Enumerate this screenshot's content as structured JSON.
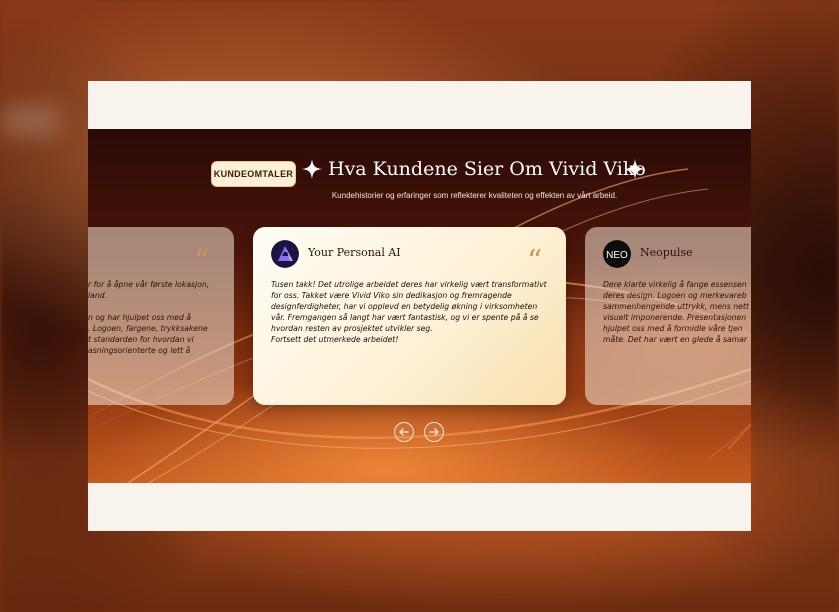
{
  "section": {
    "badge": "KUNDEOMTALER",
    "title": "Hva Kundene Sier Om Vivid Viko",
    "subtitle": "Kundehistorier og erfaringer som reflekterer kvaliteten og effekten av vårt arbeid."
  },
  "testimonials": [
    {
      "company": "",
      "logo_icon": "",
      "text": "r for å åpne vår første lokasjon,\nland.\n\nn og har hjulpet oss med å\n. Logoen, fargene, trykksakene\nt standarden for hvordan vi\nasningsorienterte og lett å"
    },
    {
      "company": "Your Personal AI",
      "logo_icon": "ai-logo-icon",
      "text": "Tusen takk! Det utrolige arbeidet deres har virkelig vært transformativt for oss. Takket være Vivid Viko sin dedikasjon og fremragende designferdigheter, har vi opplevd en betydelig økning i virksomheten vår. Fremgangen så langt har vært fantastisk, og vi er spente på å se hvordan resten av prosjektet utvikler seg.\nFortsett det utmerkede arbeidet!"
    },
    {
      "company": "Neopulse",
      "logo_icon": "neopulse-logo-icon",
      "logo_text": "NEO",
      "text": "Dere klarte virkelig å fange essensen\nderes design. Logoen og merkevareb\nsammenhengende uttrykk, mens nett\nvisuelt imponerende. Presentasjonen\nhjulpet oss med å formidle våre tjen\nmåte. Det har vært en glede å samar"
    }
  ],
  "navigation": {
    "prev_icon": "arrow-left-icon",
    "next_icon": "arrow-right-icon"
  },
  "colors": {
    "accent_gold": "#c79a55",
    "badge_bg": "#fbf0d6",
    "page_bg": "#f8f3ec"
  }
}
